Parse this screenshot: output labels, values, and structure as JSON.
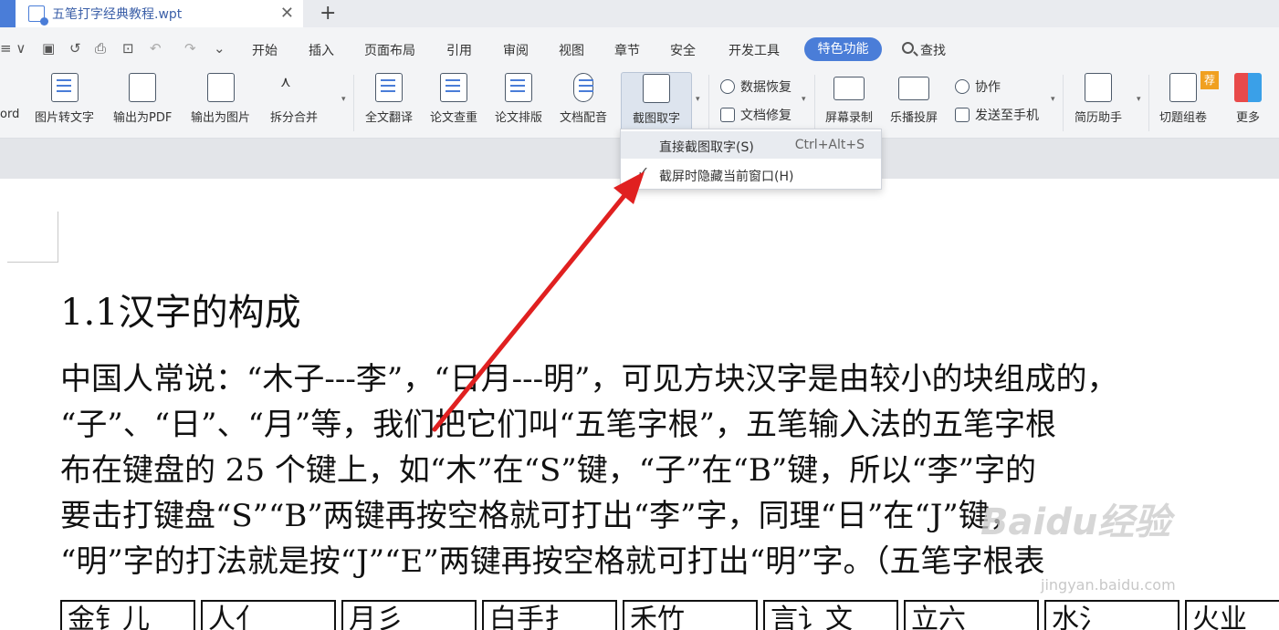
{
  "tabbar": {
    "doc_tab": "五笔打字经典教程.wpt",
    "close": "✕",
    "new_tab": "+"
  },
  "menu": {
    "left_fragment": "≡ ∨",
    "items": [
      "开始",
      "插入",
      "页面布局",
      "引用",
      "审阅",
      "视图",
      "章节",
      "安全",
      "开发工具"
    ],
    "active": "特色功能",
    "search": "查找",
    "accent_color": "#4a7dd8"
  },
  "ribbon": {
    "partial_left": "ord",
    "buttons": [
      {
        "label": "图片转文字",
        "icon": "image-to-text-icon"
      },
      {
        "label": "输出为PDF",
        "icon": "export-pdf-icon"
      },
      {
        "label": "输出为图片",
        "icon": "export-image-icon"
      },
      {
        "label": "拆分合并",
        "icon": "split-merge-icon"
      },
      {
        "label": "全文翻译",
        "icon": "translate-icon"
      },
      {
        "label": "论文查重",
        "icon": "paper-check-icon"
      },
      {
        "label": "论文排版",
        "icon": "paper-layout-icon"
      },
      {
        "label": "文档配音",
        "icon": "microphone-icon"
      },
      {
        "label": "截图取字",
        "icon": "screenshot-ocr-icon"
      },
      {
        "label": "屏幕录制",
        "icon": "screen-record-icon"
      },
      {
        "label": "乐播投屏",
        "icon": "cast-screen-icon"
      },
      {
        "label": "简历助手",
        "icon": "resume-icon"
      },
      {
        "label": "切题组卷",
        "icon": "exam-paper-icon"
      },
      {
        "label": "更多",
        "icon": "more-apps-icon"
      }
    ],
    "small": {
      "data_recovery": "数据恢复",
      "doc_repair": "文档修复",
      "collaborate": "协作",
      "send_to_phone": "发送至手机"
    },
    "badge": "荐"
  },
  "dropdown": {
    "item1": "直接截图取字(S)",
    "item1_shortcut": "Ctrl+Alt+S",
    "item2": "截屏时隐藏当前窗口(H)",
    "item2_checked": true
  },
  "document": {
    "heading": "1.1汉字的构成",
    "lines": [
      "中国人常说：“木子---李”，“日月---明”，可见方块汉字是由较小的块组成的，",
      "“子”、“日”、“月”等，我们把它们叫“五笔字根”，五笔输入法的五笔字根",
      "布在键盘的 25 个键上，如“木”在“S”键，“子”在“B”键，所以“李”字的",
      "要击打键盘“S”“B”两键再按空格就可打出“李”字，同理“日”在“J”键，",
      "“明”字的打法就是按“J”“E”两键再按空格就可打出“明”字。（五笔字根表"
    ],
    "table_cells": [
      "金钅儿",
      "人亻",
      "月彡",
      "白手扌",
      "禾竹",
      "言讠文",
      "立六",
      "水氵",
      "火业"
    ]
  },
  "watermark": {
    "main": "Baidu经验",
    "sub": "jingyan.baidu.com"
  },
  "annotation_arrow_color": "#e02020"
}
